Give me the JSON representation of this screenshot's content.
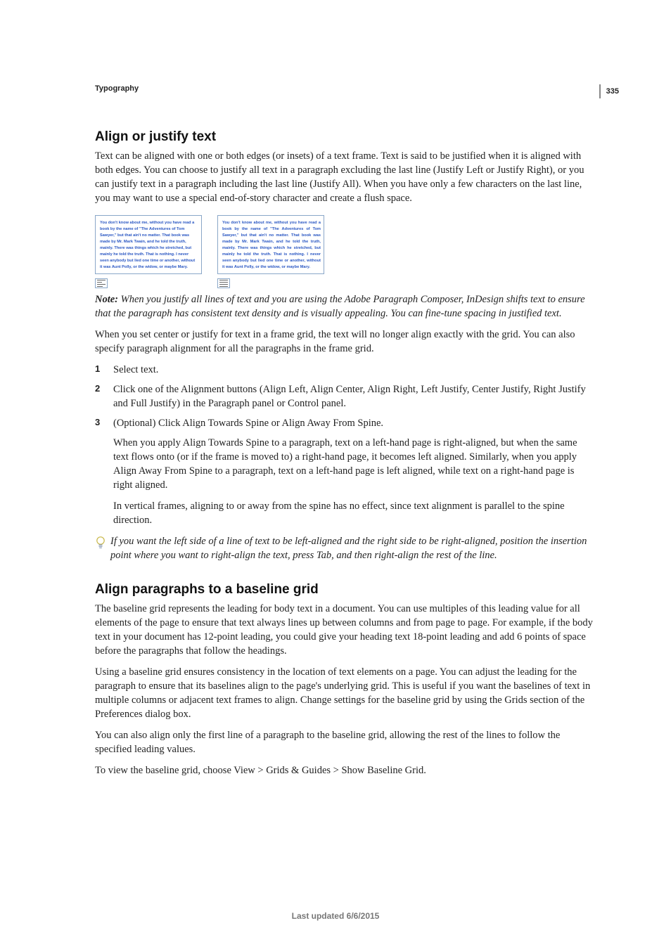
{
  "pageNumber": "335",
  "sectionLabel": "Typography",
  "h1a": "Align or justify text",
  "p1": "Text can be aligned with one or both edges (or insets) of a text frame. Text is said to be justified when it is aligned with both edges. You can choose to justify all text in a paragraph excluding the last line (Justify Left or Justify Right), or you can justify text in a paragraph including the last line (Justify All). When you have only a few characters on the last line, you may want to use a special end-of-story character and create a flush space.",
  "sampleLeft": "You don't know about me, without you have read a book by the name of \"The Adventures of Tom Sawyer,\" but that ain't no matter. That book was made by Mr. Mark Twain, and he told the truth, mainly. There was things which he stretched, but mainly he told the truth. That is nothing. I never seen anybody but lied one time or another, without it was Aunt Polly, or the widow, or maybe Mary.",
  "sampleRight": "You don't know about me, without you have read a book by the name of \"The Adventures of Tom Sawyer,\" but that ain't no matter. That book was made by Mr. Mark Twain, and he told the truth, mainly. There was things which he stretched, but mainly he told the truth. That is nothing. I never seen anybody but lied one time or another, without it was Aunt Polly, or the widow, or maybe Mary.",
  "note": "Note: When you justify all lines of text and you are using the Adobe Paragraph Composer, InDesign shifts text to ensure that the paragraph has consistent text density and is visually appealing. You can fine-tune spacing in justified text.",
  "p2": "When you set center or justify for text in a frame grid, the text will no longer align exactly with the grid. You can also specify paragraph alignment for all the paragraphs in the frame grid.",
  "steps": [
    "Select text.",
    "Click one of the Alignment buttons (Align Left, Align Center, Align Right, Left Justify, Center Justify, Right Justify and Full Justify) in the Paragraph panel or Control panel.",
    "(Optional) Click Align Towards Spine or Align Away From Spine."
  ],
  "sub1": "When you apply Align Towards Spine to a paragraph, text on a left-hand page is right-aligned, but when the same text flows onto (or if the frame is moved to) a right-hand page, it becomes left aligned. Similarly, when you apply Align Away From Spine to a paragraph, text on a left-hand page is left aligned, while text on a right-hand page is right aligned.",
  "sub2": "In vertical frames, aligning to or away from the spine has no effect, since text alignment is parallel to the spine direction.",
  "tip": "If you want the left side of a line of text to be left-aligned and the right side to be right-aligned, position the insertion point where you want to right-align the text, press Tab, and then right-align the rest of the line.",
  "h1b": "Align paragraphs to a baseline grid",
  "p3": "The baseline grid represents the leading for body text in a document. You can use multiples of this leading value for all elements of the page to ensure that text always lines up between columns and from page to page. For example, if the body text in your document has 12-point leading, you could give your heading text 18-point leading and add 6 points of space before the paragraphs that follow the headings.",
  "p4": "Using a baseline grid ensures consistency in the location of text elements on a page. You can adjust the leading for the paragraph to ensure that its baselines align to the page's underlying grid. This is useful if you want the baselines of text in multiple columns or adjacent text frames to align. Change settings for the baseline grid by using the Grids section of the Preferences dialog box.",
  "p5": "You can also align only the first line of a paragraph to the baseline grid, allowing the rest of the lines to follow the specified leading values.",
  "p6": "To view the baseline grid, choose View > Grids & Guides > Show Baseline Grid.",
  "footer": "Last updated 6/6/2015"
}
